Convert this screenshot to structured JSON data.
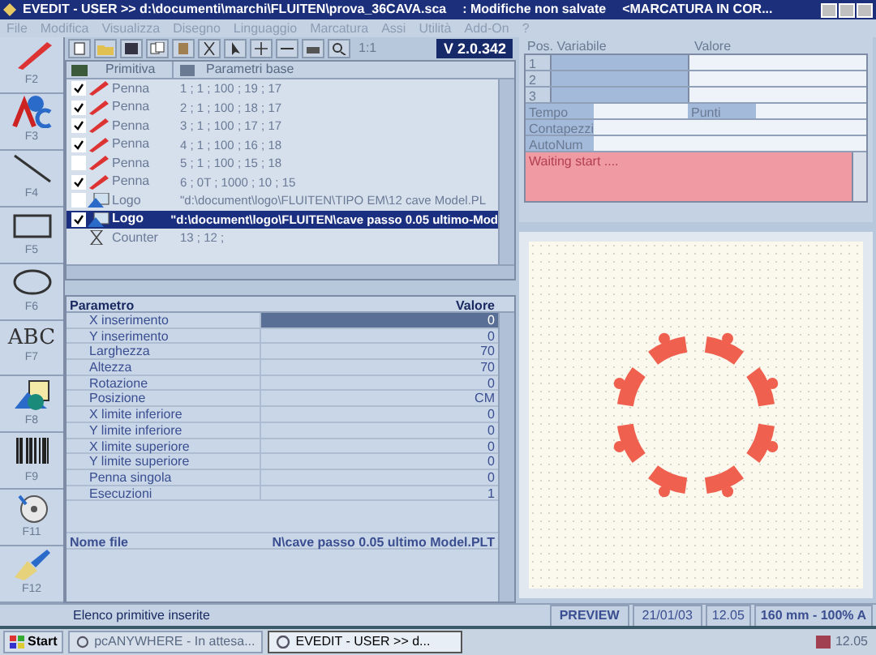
{
  "window": {
    "title": "EVEDIT - USER >> d:\\documenti\\marchi\\FLUITEN\\prova_36CAVA.sca",
    "status": ": Modifiche non salvate",
    "mode": "<MARCATURA IN COR..."
  },
  "menu": [
    {
      "label": "File",
      "disabled": true
    },
    {
      "label": "Modifica",
      "disabled": true
    },
    {
      "label": "Visualizza",
      "disabled": true
    },
    {
      "label": "Disegno",
      "disabled": true
    },
    {
      "label": "Linguaggio",
      "disabled": true
    },
    {
      "label": "Marcatura",
      "disabled": true
    },
    {
      "label": "Assi",
      "disabled": true
    },
    {
      "label": "Utilità",
      "disabled": true
    },
    {
      "label": "Add-On",
      "disabled": true
    },
    {
      "label": "?",
      "disabled": true
    }
  ],
  "tools": [
    {
      "kind": "pen",
      "key": "F2"
    },
    {
      "kind": "text",
      "key": "F3"
    },
    {
      "kind": "line",
      "key": "F4"
    },
    {
      "kind": "rect",
      "key": "F5"
    },
    {
      "kind": "ellipse",
      "key": "F6"
    },
    {
      "kind": "abc",
      "key": "F7",
      "label": "ABC"
    },
    {
      "kind": "shapes",
      "key": "F8"
    },
    {
      "kind": "barcode",
      "key": "F9"
    },
    {
      "kind": "disc",
      "key": "F11"
    },
    {
      "kind": "brush",
      "key": "F12"
    }
  ],
  "toolbar": {
    "zoom": "1:1",
    "version": "V 2.0.342"
  },
  "primitives": {
    "columns": [
      "Primitiva",
      "Parametri base"
    ],
    "rows": [
      {
        "kind": "pen",
        "checked": true,
        "selected": false,
        "name": "Penna",
        "params": "1 ; 1 ; 100 ; 19 ; 17"
      },
      {
        "kind": "pen",
        "checked": true,
        "selected": false,
        "name": "Penna",
        "params": "2 ; 1 ; 100 ; 18 ; 17"
      },
      {
        "kind": "pen",
        "checked": true,
        "selected": false,
        "name": "Penna",
        "params": "3 ; 1 ; 100 ; 17 ; 17"
      },
      {
        "kind": "pen",
        "checked": true,
        "selected": false,
        "name": "Penna",
        "params": "4 ; 1 ; 100 ; 16 ; 18"
      },
      {
        "kind": "pen",
        "checked": false,
        "selected": false,
        "name": "Penna",
        "params": "5 ; 1 ; 100 ; 15 ; 18"
      },
      {
        "kind": "pen",
        "checked": true,
        "selected": false,
        "name": "Penna",
        "params": "6 ; 0T ; 1000 ; 10 ; 15"
      },
      {
        "kind": "logo",
        "checked": false,
        "selected": false,
        "name": "Logo",
        "params": "\"d:\\document\\logo\\FLUITEN\\TIPO EM\\12 cave Model.PL"
      },
      {
        "kind": "logo",
        "checked": true,
        "selected": true,
        "name": "Logo",
        "params": "\"d:\\document\\logo\\FLUITEN\\cave passo 0.05 ultimo-Mod"
      },
      {
        "kind": "counter",
        "selected": false,
        "name": "Counter",
        "params": "13 ; 12 ;"
      }
    ]
  },
  "parameters": {
    "columns": [
      "Parametro",
      "Valore"
    ],
    "rows": [
      {
        "name": "X inserimento",
        "value": "0",
        "selected": true
      },
      {
        "name": "Y inserimento",
        "value": "0",
        "selected": false
      },
      {
        "name": "Larghezza",
        "value": "70",
        "selected": false
      },
      {
        "name": "Altezza",
        "value": "70",
        "selected": false
      },
      {
        "name": "Rotazione",
        "value": "0",
        "selected": false
      },
      {
        "name": "Posizione",
        "value": "CM",
        "selected": false
      },
      {
        "name": "X limite inferiore",
        "value": "0",
        "selected": false
      },
      {
        "name": "Y limite inferiore",
        "value": "0",
        "selected": false
      },
      {
        "name": "X limite superiore",
        "value": "0",
        "selected": false
      },
      {
        "name": "Y limite superiore",
        "value": "0",
        "selected": false
      },
      {
        "name": "Penna singola",
        "value": "0",
        "selected": false
      },
      {
        "name": "Esecuzioni",
        "value": "1",
        "selected": false
      }
    ],
    "file": {
      "name": "Nome file",
      "value": "N\\cave passo 0.05 ultimo Model.PLT"
    }
  },
  "variables": {
    "columns": [
      "Pos. Variabile",
      "Valore"
    ],
    "rows": [
      "1",
      "2",
      "3"
    ],
    "tempo": "Tempo",
    "punti": "Punti",
    "contapezzi": "Contapezzi",
    "autonum": "AutoNum",
    "log": "Waiting start ...."
  },
  "status_bar": {
    "message": "Elenco primitive inserite",
    "mode": "PREVIEW",
    "date": "21/01/03",
    "time": "12.05",
    "scale": "160 mm - 100% A"
  },
  "taskbar": {
    "start": "Start",
    "tasks": [
      {
        "label": "pcANYWHERE - In attesa...",
        "selected": false
      },
      {
        "label": "EVEDIT - USER >> d...",
        "selected": true
      }
    ],
    "clock": "12.05"
  }
}
